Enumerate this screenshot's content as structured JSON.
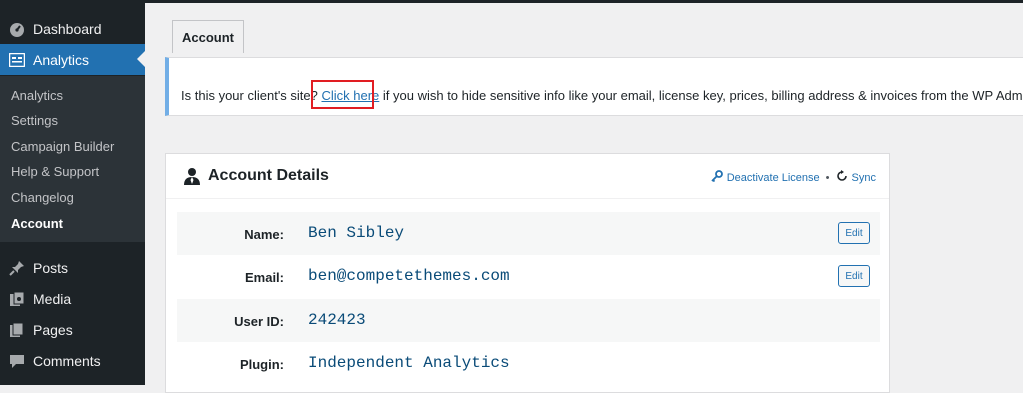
{
  "sidebar": {
    "top_items": [
      {
        "label": "Dashboard",
        "icon": "dashboard-icon"
      },
      {
        "label": "Analytics",
        "icon": "analytics-icon"
      },
      {
        "label": "Posts",
        "icon": "pin-icon"
      },
      {
        "label": "Media",
        "icon": "media-icon"
      },
      {
        "label": "Pages",
        "icon": "pages-icon"
      },
      {
        "label": "Comments",
        "icon": "comment-icon"
      }
    ],
    "submenu": [
      "Analytics",
      "Settings",
      "Campaign Builder",
      "Help & Support",
      "Changelog",
      "Account"
    ],
    "active_color": "#2271b1"
  },
  "tabs": [
    {
      "label": "Account"
    }
  ],
  "notice": {
    "before": "Is this your client's site? ",
    "link": "Click here",
    "after": " if you wish to hide sensitive info like your email, license key, prices, billing address & invoices from the WP Admin."
  },
  "account": {
    "title": "Account Details",
    "deactivate": "Deactivate License",
    "separator": "•",
    "sync": "Sync",
    "rows": [
      {
        "label": "Name:",
        "value": "Ben Sibley",
        "edit": "Edit"
      },
      {
        "label": "Email:",
        "value": "ben@competethemes.com",
        "edit": "Edit"
      },
      {
        "label": "User ID:",
        "value": "242423"
      },
      {
        "label": "Plugin:",
        "value": "Independent Analytics"
      }
    ]
  }
}
